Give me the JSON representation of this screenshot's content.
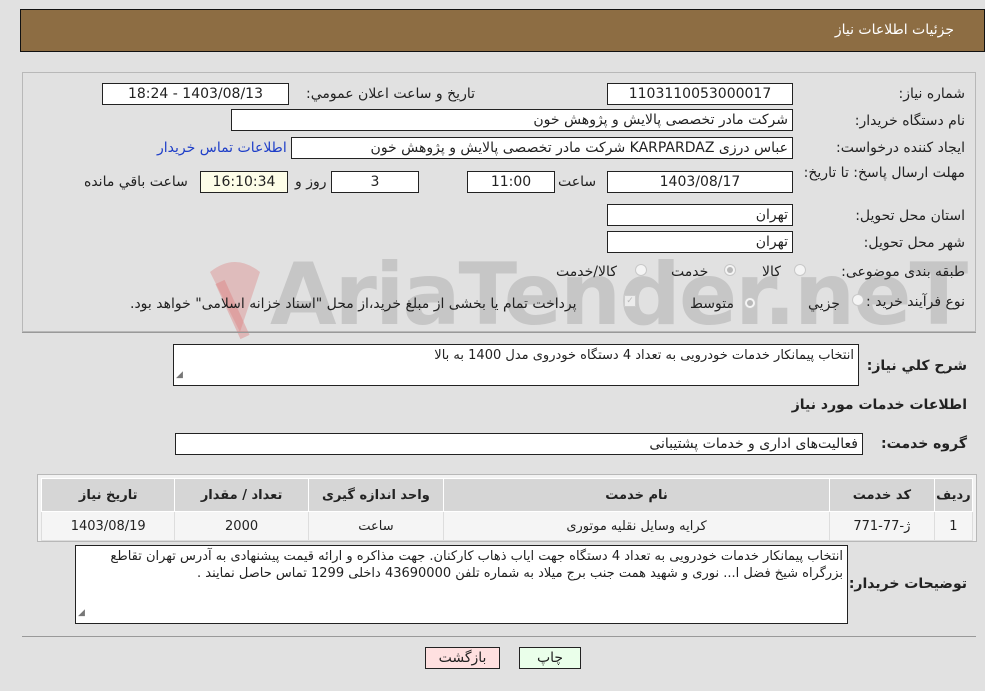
{
  "header": {
    "title": "جزئیات اطلاعات نیاز"
  },
  "form": {
    "need_number": {
      "label": "شماره نیاز:",
      "value": "1103110053000017"
    },
    "announce_datetime": {
      "label": "تاریخ و ساعت اعلان عمومي:",
      "value": "1403/08/13 - 18:24"
    },
    "buyer_org": {
      "label": "نام دستگاه خریدار:",
      "value": "شرکت مادر تخصصی پالایش و پژوهش خون"
    },
    "requester": {
      "label": "ایجاد کننده درخواست:",
      "value": "عباس درزی KARPARDAZ شرکت مادر تخصصی پالایش و پژوهش خون",
      "contact_link": "اطلاعات تماس خریدار"
    },
    "deadline": {
      "label": "مهلت ارسال پاسخ: تا تاریخ:",
      "date": "1403/08/17",
      "time_label": "ساعت",
      "time": "11:00",
      "days": "3",
      "days_label": "روز و",
      "remaining": "16:10:34",
      "remaining_label": "ساعت باقي مانده"
    },
    "province": {
      "label": "استان محل تحویل:",
      "value": "تهران"
    },
    "city": {
      "label": "شهر محل تحویل:",
      "value": "تهران"
    },
    "category": {
      "label": "طبقه بندی موضوعی:",
      "options": [
        "کالا",
        "خدمت",
        "کالا/خدمت"
      ],
      "selected": "خدمت"
    },
    "purchase_type": {
      "label": "نوع فرآیند خرید :",
      "options": [
        "جزيي",
        "متوسط"
      ],
      "selected": "متوسط",
      "treasury_note": "پرداخت تمام یا بخشی از مبلغ خرید،از محل \"اسناد خزانه اسلامی\" خواهد بود."
    }
  },
  "description": {
    "label": "شرح کلي نياز:",
    "value": "انتخاب پیمانکار خدمات خودرویی به تعداد 4 دستگاه خودروی مدل 1400 به بالا"
  },
  "services": {
    "section_title": "اطلاعات خدمات مورد نياز",
    "group_label": "گروه خدمت:",
    "group_value": "فعالیت‌های اداری و خدمات پشتیبانی",
    "table": {
      "headers": [
        "رديف",
        "کد خدمت",
        "نام خدمت",
        "واحد اندازه گیری",
        "تعداد / مقدار",
        "تاریخ نیاز"
      ],
      "rows": [
        [
          "1",
          "ژ-77-771",
          "کرایه وسایل نقلیه موتوری",
          "ساعت",
          "2000",
          "1403/08/19"
        ]
      ]
    }
  },
  "buyer_notes": {
    "label": "توضيحات خريدار:",
    "value": "انتخاب پیمانکار خدمات خودرویی به تعداد 4 دستگاه  جهت ایاب ذهاب کارکنان.  جهت مذاکره  و ارائه قیمت پیشنهادی به آدرس تهران تقاطع بزرگراه شیخ فضل ا... نوری و شهید همت جنب برج میلاد به شماره تلفن 43690000 داخلی   1299 تماس حاصل نمایند ."
  },
  "buttons": {
    "print": "چاپ",
    "back": "بازگشت"
  },
  "watermark": "AriaTender.neT",
  "colors": {
    "header_bg": "#8d6d43",
    "print_bg": "#eaffea",
    "back_bg": "#ffe0e0",
    "link": "#1e3ec8"
  }
}
